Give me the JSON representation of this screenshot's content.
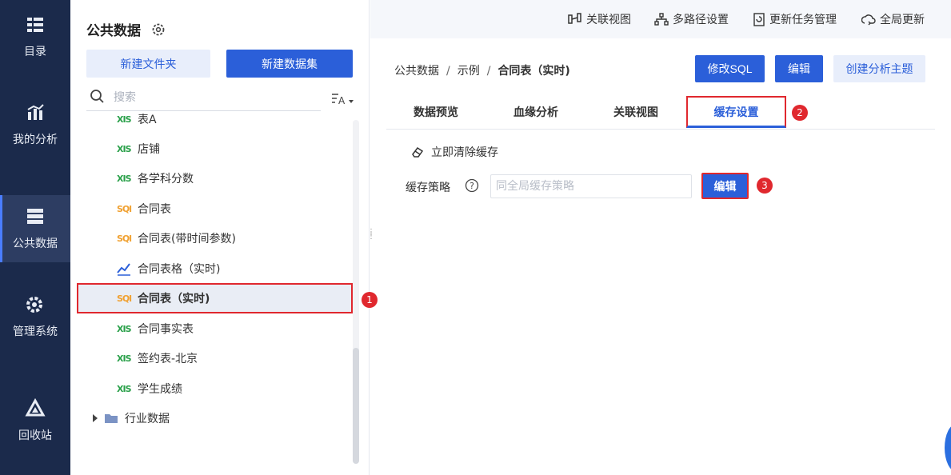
{
  "nav": {
    "items": [
      {
        "label": "目录",
        "icon": "list-icon"
      },
      {
        "label": "我的分析",
        "icon": "chart-icon"
      },
      {
        "label": "公共数据",
        "icon": "database-icon"
      },
      {
        "label": "管理系统",
        "icon": "gear-icon"
      },
      {
        "label": "回收站",
        "icon": "recycle-icon"
      }
    ],
    "active_index": 2
  },
  "tree": {
    "title": "公共数据",
    "new_folder_label": "新建文件夹",
    "new_dataset_label": "新建数据集",
    "search_placeholder": "搜索",
    "items": [
      {
        "type": "xls",
        "icon_text": "XIS",
        "label": "表A"
      },
      {
        "type": "xls",
        "icon_text": "XIS",
        "label": "店铺"
      },
      {
        "type": "xls",
        "icon_text": "XIS",
        "label": "各学科分数"
      },
      {
        "type": "sql",
        "icon_text": "SQl",
        "label": "合同表"
      },
      {
        "type": "sql",
        "icon_text": "SQl",
        "label": "合同表(带时间参数)"
      },
      {
        "type": "chart",
        "icon_text": "",
        "label": "合同表格（实时)"
      },
      {
        "type": "sql",
        "icon_text": "SQl",
        "label": "合同表（实时)"
      },
      {
        "type": "xls",
        "icon_text": "XIS",
        "label": "合同事实表"
      },
      {
        "type": "xls",
        "icon_text": "XIS",
        "label": "签约表-北京"
      },
      {
        "type": "xls",
        "icon_text": "XIS",
        "label": "学生成绩"
      }
    ],
    "folder_label": "行业数据",
    "selected_index": 6
  },
  "badges": {
    "one": "1",
    "two": "2",
    "three": "3"
  },
  "topbar": {
    "related_view": "关联视图",
    "multi_path": "多路径设置",
    "update_task": "更新任务管理",
    "global_update": "全局更新"
  },
  "breadcrumb": {
    "root": "公共数据",
    "mid": "示例",
    "current": "合同表（实时)",
    "sep": "/"
  },
  "actions": {
    "edit_sql": "修改SQL",
    "edit": "编辑",
    "create_topic": "创建分析主题"
  },
  "tabs": [
    {
      "label": "数据预览"
    },
    {
      "label": "血缘分析"
    },
    {
      "label": "关联视图"
    },
    {
      "label": "缓存设置"
    }
  ],
  "cache": {
    "clear_label": "立即清除缓存",
    "strategy_label": "缓存策略",
    "strategy_placeholder": "同全局缓存策略",
    "edit_label": "编辑"
  },
  "colors": {
    "accent": "#2b5fd9",
    "highlight": "#e0282e",
    "nav_bg": "#1b2a4b"
  }
}
